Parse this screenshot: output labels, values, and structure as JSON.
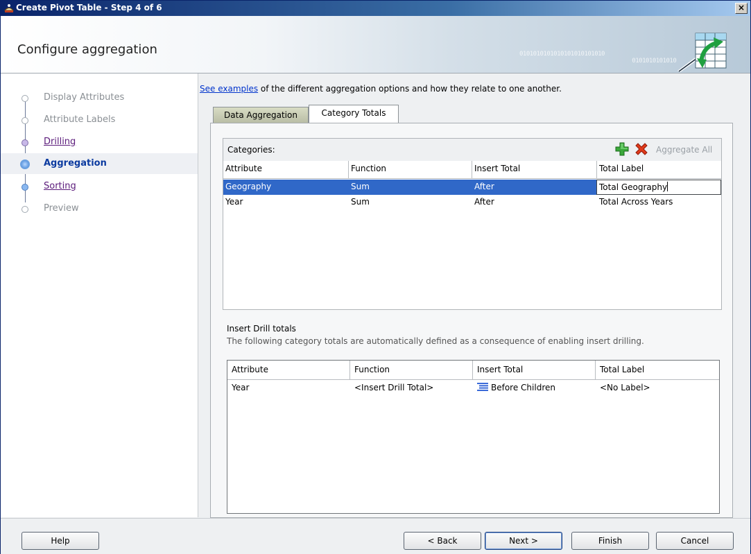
{
  "window": {
    "title": "Create Pivot Table - Step 4 of 6",
    "close_label": "×"
  },
  "header": {
    "title": "Configure aggregation",
    "decoration_text": "0101010101010101010101010\n                                 0101010101010"
  },
  "steps": [
    {
      "label": "Display Attributes",
      "state": "disabled"
    },
    {
      "label": "Attribute Labels",
      "state": "disabled"
    },
    {
      "label": "Drilling",
      "state": "link"
    },
    {
      "label": "Aggregation",
      "state": "active"
    },
    {
      "label": "Sorting",
      "state": "link"
    },
    {
      "label": "Preview",
      "state": "disabled"
    }
  ],
  "intro": {
    "link": "See examples",
    "text": " of the different aggregation options and how they relate to one another."
  },
  "tabs": [
    {
      "label": "Data Aggregation",
      "selected": false
    },
    {
      "label": "Category Totals",
      "selected": true
    }
  ],
  "categories": {
    "label": "Categories:",
    "add_icon": "add-icon",
    "delete_icon": "delete-icon",
    "aggregate_all": "Aggregate All",
    "columns": [
      "Attribute",
      "Function",
      "Insert Total",
      "Total Label"
    ],
    "rows": [
      {
        "attribute": "Geography",
        "function": "Sum",
        "insert_total": "After",
        "total_label": "Total Geography",
        "selected": true
      },
      {
        "attribute": "Year",
        "function": "Sum",
        "insert_total": "After",
        "total_label": "Total Across Years",
        "selected": false
      }
    ]
  },
  "drill": {
    "title": "Insert Drill totals",
    "description": "The following category totals are automatically defined as a consequence of enabling insert drilling.",
    "columns": [
      "Attribute",
      "Function",
      "Insert Total",
      "Total Label"
    ],
    "rows": [
      {
        "attribute": "Year",
        "function": "<Insert Drill Total>",
        "insert_total": "Before Children",
        "total_label": "<No Label>"
      }
    ]
  },
  "buttons": {
    "help": "Help",
    "back": "< Back",
    "next": "Next >",
    "finish": "Finish",
    "cancel": "Cancel"
  },
  "colors": {
    "selection": "#3068c8",
    "active_step": "#0c3ba0",
    "link": "#0033cc"
  }
}
